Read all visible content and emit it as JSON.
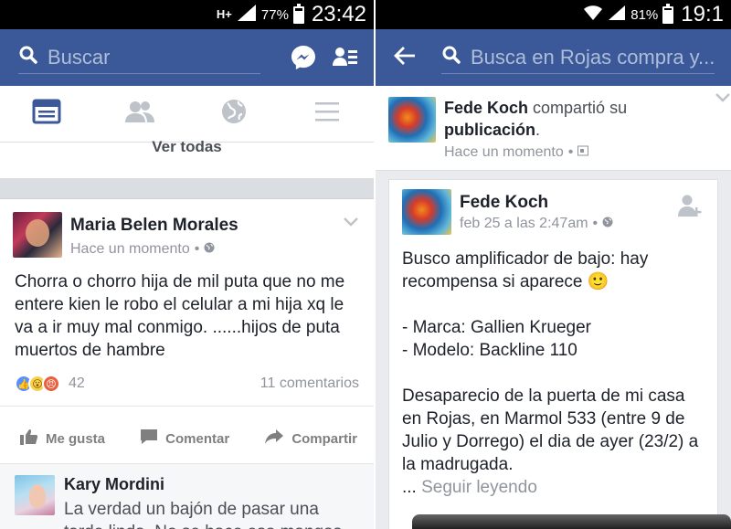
{
  "left": {
    "status": {
      "network": "H+",
      "battery_pct": "77%",
      "battery_level": 0.77,
      "time": "23:42"
    },
    "search": {
      "placeholder": "Buscar"
    },
    "see_all": "Ver todas",
    "post": {
      "author": "Maria Belen Morales",
      "time": "Hace un momento",
      "text": "Chorra o chorro hija de mil puta que no me entere kien le robo el celular a mi hija xq le va a ir muy mal conmigo.  ......hijos de puta muertos de hambre",
      "reaction_count": "42",
      "comments": "11 comentarios",
      "actions": {
        "like": "Me gusta",
        "comment": "Comentar",
        "share": "Compartir"
      }
    },
    "comment": {
      "author": "Kary Mordini",
      "text": "La verdad un bajón de pasar una tarde linda .No se hace eso mangas"
    }
  },
  "right": {
    "status": {
      "battery_pct": "81%",
      "battery_level": 0.81,
      "time": "19:1"
    },
    "search": {
      "placeholder": "Busca en Rojas compra y..."
    },
    "share": {
      "author": "Fede Koch",
      "verb": "compartió su",
      "object": "publicación",
      "period": ".",
      "time": "Hace un momento"
    },
    "post": {
      "author": "Fede Koch",
      "time": "feb 25 a las 2:47am",
      "line1": "Busco amplificador de bajo: hay recompensa si aparece 🙂",
      "line2": "- Marca: Gallien Krueger",
      "line3": "- Modelo: Backline 110",
      "line4": "Desaparecio de la puerta de mi casa en Rojas, en Marmol 533 (entre 9 de Julio y Dorrego) el dia de ayer (23/2) a la madrugada.",
      "ellipsis": "...",
      "see_more": "Seguir leyendo"
    }
  },
  "colors": {
    "facebook_blue": "#3b5998",
    "muted": "#90949c"
  }
}
